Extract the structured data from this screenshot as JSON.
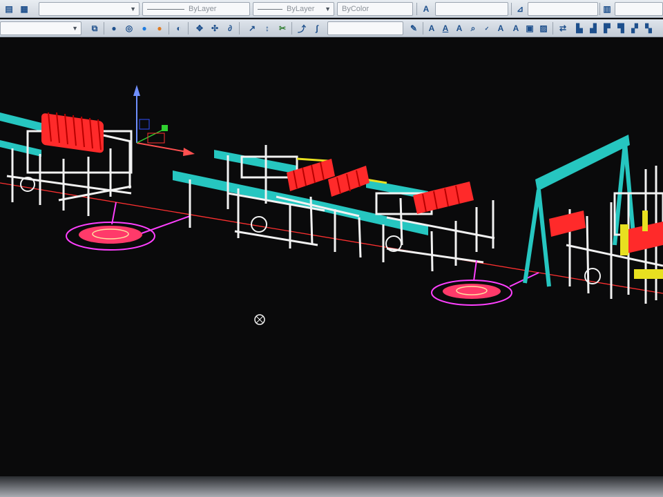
{
  "toolbar_top": {
    "linetype_value": "ByLayer",
    "lineweight_value": "ByLayer",
    "plotstyle_value": "ByColor"
  },
  "icons": {
    "row1": [
      "layer-manager-icon",
      "layer-state-icon",
      "text-style-icon",
      "dimension-style-icon",
      "table-style-icon"
    ],
    "row2": [
      "layer-previous-icon",
      "layer-isolate-icon",
      "sphere-icon",
      "material-icon",
      "render-icon",
      "orbit-icon",
      "walk-icon",
      "fly-icon",
      "pan-icon",
      "zoom-icon",
      "text-icon",
      "multiline-text-icon",
      "spell-check-icon",
      "find-text-icon",
      "scale-text-icon",
      "justify-text-icon",
      "block-icon",
      "attribute-icon"
    ]
  },
  "colors": {
    "background": "#0a0a0b",
    "frame_white": "#f2f2f2",
    "rail_cyan": "#26c6c0",
    "rollers_red": "#ff2a2a",
    "ucs_red_axis": "#ff3030",
    "magenta_marker": "#ff40ff",
    "yellow_part": "#e8e020"
  }
}
